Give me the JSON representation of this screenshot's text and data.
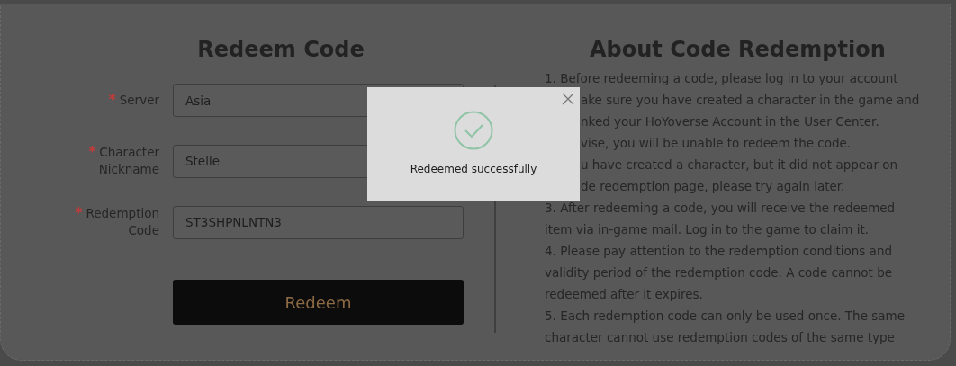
{
  "redeem_form": {
    "title": "Redeem Code",
    "fields": [
      {
        "label_lines": [
          "Server"
        ],
        "required": true,
        "value": "Asia"
      },
      {
        "label_lines": [
          "Character",
          "Nickname"
        ],
        "required": true,
        "value": "Stelle"
      },
      {
        "label_lines": [
          "Redemption",
          "Code"
        ],
        "required": true,
        "value": "ST3SHPNLNTN3"
      }
    ],
    "required_mark": "*",
    "button": "Redeem"
  },
  "about": {
    "title": "About Code Redemption",
    "lines": [
      {
        "kind": "full",
        "text": "1. Before redeeming a code, please log in to your account"
      },
      {
        "kind": "partial",
        "text": "ake sure you have created a character in the game and"
      },
      {
        "kind": "partial",
        "text": "nked your HoYoverse Account in the User Center."
      },
      {
        "kind": "partial",
        "text": "vise, you will be unable to redeem the code."
      },
      {
        "kind": "partial",
        "text": "u have created a character, but it did not appear on"
      },
      {
        "kind": "partial",
        "text": "de redemption page, please try again later."
      },
      {
        "kind": "full",
        "text": "3. After redeeming a code, you will receive the redeemed"
      },
      {
        "kind": "full",
        "text": "item via in-game mail. Log in to the game to claim it."
      },
      {
        "kind": "full",
        "text": "4. Please pay attention to the redemption conditions and"
      },
      {
        "kind": "full",
        "text": "validity period of the redemption code. A code cannot be"
      },
      {
        "kind": "full",
        "text": "redeemed after it expires."
      },
      {
        "kind": "full",
        "text": "5. Each redemption code can only be used once. The same"
      },
      {
        "kind": "full",
        "text": "character cannot use redemption codes of the same type"
      }
    ]
  },
  "dialog": {
    "message": "Redeemed successfully"
  }
}
